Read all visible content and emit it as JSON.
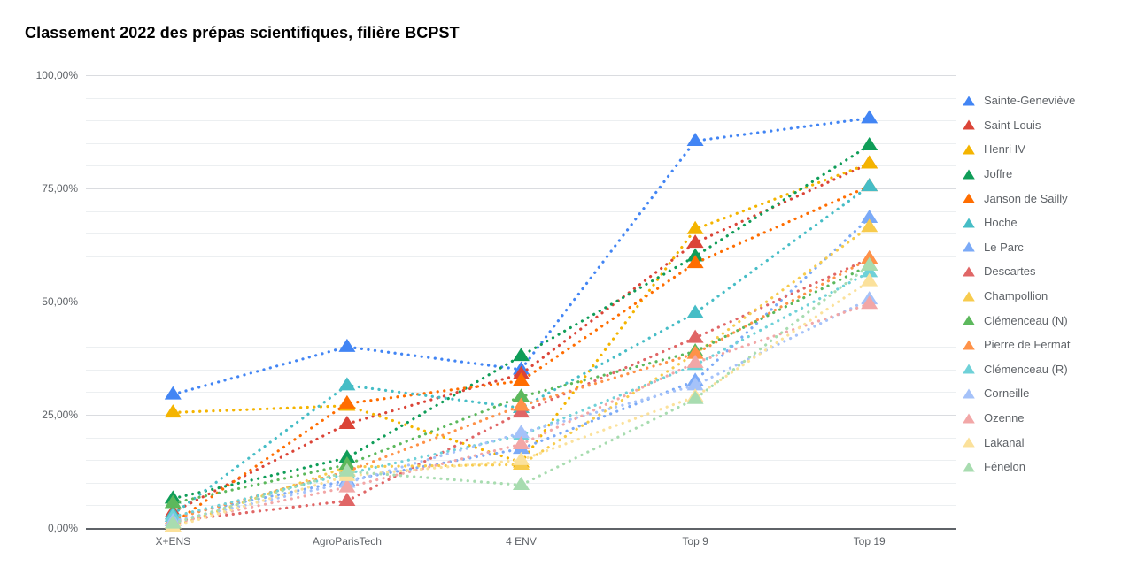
{
  "chart_data": {
    "type": "line",
    "title": "Classement 2022 des prépas scientifiques, filière BCPST",
    "xlabel": "",
    "ylabel": "",
    "grid": true,
    "legend_position": "right",
    "ylim": [
      0,
      100
    ],
    "ytick_labels": [
      "0,00%",
      "25,00%",
      "50,00%",
      "75,00%",
      "100,00%"
    ],
    "ytick_values": [
      0,
      25,
      50,
      75,
      100
    ],
    "minor_tick_step": 5,
    "categories": [
      "X+ENS",
      "AgroParisTech",
      "4 ENV",
      "Top 9",
      "Top 19"
    ],
    "series": [
      {
        "name": "Sainte-Geneviève",
        "color": "#4285f4",
        "values": [
          29.5,
          40.0,
          35.0,
          85.5,
          90.5
        ]
      },
      {
        "name": "Saint Louis",
        "color": "#db4437",
        "values": [
          3.5,
          23.0,
          34.0,
          63.0,
          80.5
        ]
      },
      {
        "name": "Henri IV",
        "color": "#f4b400",
        "values": [
          25.5,
          27.0,
          14.5,
          66.0,
          80.5
        ]
      },
      {
        "name": "Joffre",
        "color": "#0f9d58",
        "values": [
          6.5,
          15.5,
          38.0,
          60.0,
          84.5
        ]
      },
      {
        "name": "Janson de Sailly",
        "color": "#ff6d00",
        "values": [
          1.0,
          27.5,
          32.5,
          58.5,
          75.5
        ]
      },
      {
        "name": "Hoche",
        "color": "#46bdc6",
        "values": [
          3.0,
          31.5,
          26.5,
          47.5,
          75.5
        ]
      },
      {
        "name": "Le Parc",
        "color": "#7baaf7",
        "values": [
          2.5,
          10.5,
          17.5,
          32.5,
          68.5
        ]
      },
      {
        "name": "Descartes",
        "color": "#e06666",
        "values": [
          1.5,
          6.0,
          25.5,
          42.0,
          59.5
        ]
      },
      {
        "name": "Champollion",
        "color": "#f7cb4d",
        "values": [
          0.3,
          13.5,
          14.0,
          38.5,
          66.5
        ]
      },
      {
        "name": "Clémenceau (N)",
        "color": "#5cb85c",
        "values": [
          5.5,
          14.0,
          29.0,
          39.0,
          58.0
        ]
      },
      {
        "name": "Pierre de Fermat",
        "color": "#ff9248",
        "values": [
          2.0,
          12.5,
          27.0,
          38.5,
          59.5
        ]
      },
      {
        "name": "Clémenceau (R)",
        "color": "#6fd1d8",
        "values": [
          2.5,
          12.0,
          20.5,
          36.0,
          56.5
        ]
      },
      {
        "name": "Corneille",
        "color": "#a5c2f9",
        "values": [
          1.5,
          10.0,
          21.0,
          31.5,
          50.5
        ]
      },
      {
        "name": "Ozenne",
        "color": "#f2a7a7",
        "values": [
          1.0,
          9.0,
          18.5,
          36.5,
          49.5
        ]
      },
      {
        "name": "Lakanal",
        "color": "#fbe19b",
        "values": [
          0.2,
          11.5,
          15.0,
          29.0,
          54.5
        ]
      },
      {
        "name": "Fénelon",
        "color": "#a8dcb0",
        "values": [
          1.0,
          12.5,
          9.5,
          28.5,
          58.0
        ]
      }
    ]
  },
  "legend": {
    "items": [
      {
        "label": "Sainte-Geneviève"
      },
      {
        "label": "Saint Louis"
      },
      {
        "label": "Henri IV"
      },
      {
        "label": "Joffre"
      },
      {
        "label": "Janson de Sailly"
      },
      {
        "label": "Hoche"
      },
      {
        "label": "Le Parc"
      },
      {
        "label": "Descartes"
      },
      {
        "label": "Champollion"
      },
      {
        "label": "Clémenceau (N)"
      },
      {
        "label": "Pierre de Fermat"
      },
      {
        "label": "Clémenceau (R)"
      },
      {
        "label": "Corneille"
      },
      {
        "label": "Ozenne"
      },
      {
        "label": "Lakanal"
      },
      {
        "label": "Fénelon"
      }
    ]
  }
}
